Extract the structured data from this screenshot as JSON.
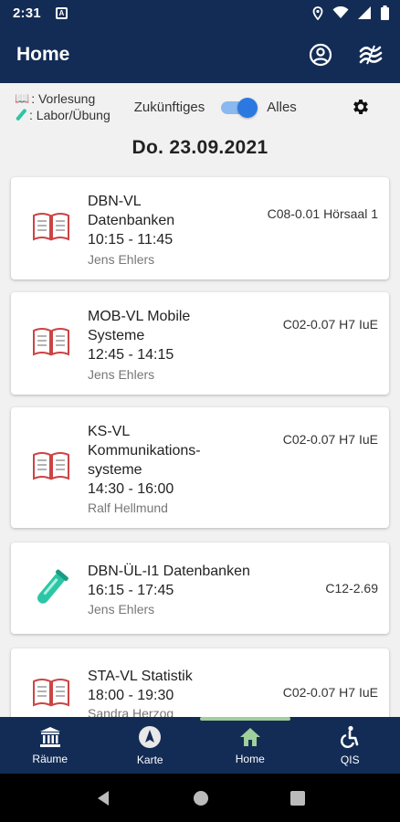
{
  "status_bar": {
    "time": "2:31",
    "notification_icon": "A"
  },
  "app_bar": {
    "title": "Home",
    "icons": [
      "account-circle-icon",
      "waves-logo-icon"
    ]
  },
  "legend": {
    "lecture_label": ": Vorlesung",
    "lab_label": ": Labor/Übung"
  },
  "filter": {
    "left_label": "Zukünftiges",
    "right_label": "Alles",
    "toggle_on": true
  },
  "date_header": "Do. 23.09.2021",
  "events": [
    {
      "type": "lecture",
      "name_lines": [
        "DBN-VL",
        "Datenbanken"
      ],
      "time": "10:15 - 11:45",
      "lecturer": "Jens Ehlers",
      "room": "C08-0.01 Hörsaal 1"
    },
    {
      "type": "lecture",
      "name_lines": [
        "MOB-VL Mobile",
        "Systeme"
      ],
      "time": "12:45 - 14:15",
      "lecturer": "Jens Ehlers",
      "room": "C02-0.07 H7 IuE"
    },
    {
      "type": "lecture",
      "name_lines": [
        "KS-VL",
        "Kommunikations-",
        "systeme"
      ],
      "time": "14:30 - 16:00",
      "lecturer": "Ralf Hellmund",
      "room": "C02-0.07 H7 IuE"
    },
    {
      "type": "lab",
      "name_lines": [
        "DBN-ÜL-I1 Datenbanken"
      ],
      "time": "16:15 - 17:45",
      "lecturer": "Jens Ehlers",
      "room": "C12-2.69"
    },
    {
      "type": "lecture",
      "name_lines": [
        "STA-VL Statistik"
      ],
      "time": "18:00 - 19:30",
      "lecturer": "Sandra Herzog",
      "room": "C02-0.07 H7 IuE"
    }
  ],
  "bottom_nav": [
    {
      "label": "Räume",
      "icon": "building-icon",
      "active": false
    },
    {
      "label": "Karte",
      "icon": "compass-icon",
      "active": false
    },
    {
      "label": "Home",
      "icon": "home-icon",
      "active": true
    },
    {
      "label": "QIS",
      "icon": "accessibility-icon",
      "active": false
    }
  ],
  "colors": {
    "primary": "#132c55",
    "background": "#f1f1f1",
    "switch": "#2b79e0",
    "active_indicator": "#9fcf9a",
    "lab_icon": "#2cc6a6"
  }
}
